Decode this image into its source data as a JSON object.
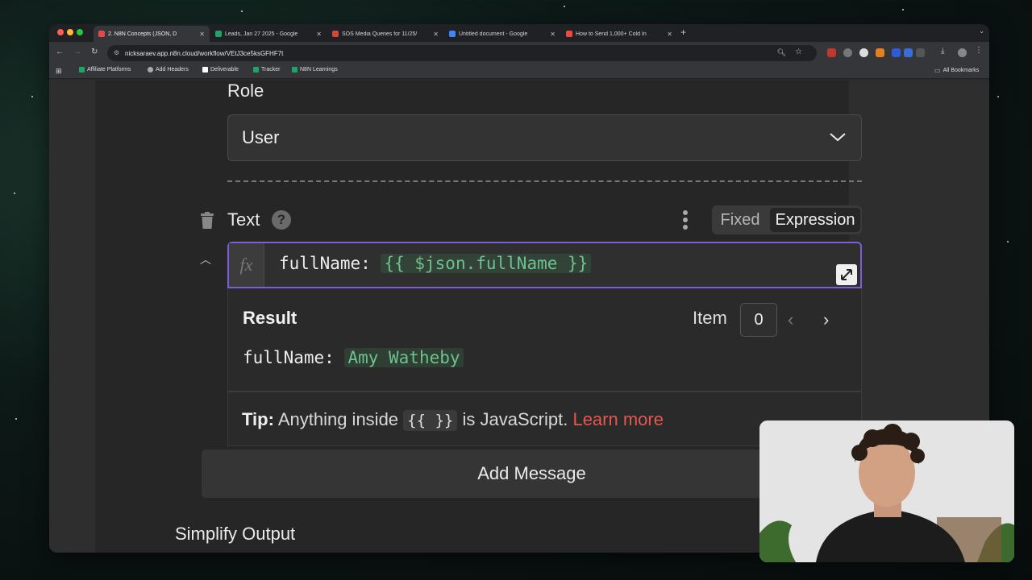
{
  "browser": {
    "tabs": [
      {
        "title": "2. N8N Concepts (JSON, D",
        "color": "#e14b4b",
        "active": true
      },
      {
        "title": "Leads, Jan 27 2025 - Google",
        "color": "#1fa463",
        "active": false
      },
      {
        "title": "SOS Media Queries for 11/25/",
        "color": "#d44638",
        "active": false
      },
      {
        "title": "Untitled document - Google",
        "color": "#4285f4",
        "active": false
      },
      {
        "title": "How to Send 1,000+ Cold In",
        "color": "#e94b3c",
        "active": false
      }
    ],
    "url": "nicksaraev.app.n8n.cloud/workflow/VEtJ3ce5ksGFHF7t",
    "bookmarks": [
      {
        "label": "Affiliate Platforms",
        "color": "#1fa463"
      },
      {
        "label": "Add Headers",
        "color": "#aaaaaa"
      },
      {
        "label": "Deliverable",
        "color": "#ffffff"
      },
      {
        "label": "Tracker",
        "color": "#1fa463"
      },
      {
        "label": "N8N Learnings",
        "color": "#1fa463"
      }
    ],
    "all_bookmarks": "All Bookmarks"
  },
  "form": {
    "role_label": "Role",
    "role_value": "User",
    "text_label": "Text",
    "mode_fixed": "Fixed",
    "mode_expression": "Expression",
    "fx_symbol": "fx",
    "expression_key": "fullName: ",
    "expression_value": "{{ $json.fullName }}",
    "result_title": "Result",
    "item_label": "Item",
    "item_index": "0",
    "result_key": "fullName: ",
    "result_value": "Amy Watheby",
    "tip_prefix": "Tip:",
    "tip_text": "Anything inside",
    "tip_code": "{{ }}",
    "tip_suffix": "is JavaScript.",
    "tip_link": "Learn more",
    "add_message": "Add Message",
    "simplify_output": "Simplify Output"
  },
  "colors": {
    "accent_purple": "#7a5fd6",
    "expression_green": "#6cc28e",
    "link_red": "#e4574e"
  }
}
